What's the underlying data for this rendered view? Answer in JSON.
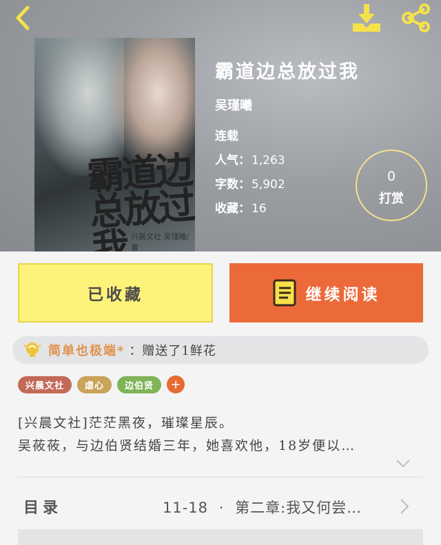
{
  "icons": {
    "back": "back-chevron-icon",
    "download": "download-icon",
    "share": "share-icon",
    "read": "book-icon",
    "flower": "lightbulb-icon",
    "expand": "chevron-down-icon",
    "toc": "chevron-right-icon"
  },
  "colors": {
    "accent_yellow": "#f5e24a",
    "fav_button": "#fdf27a",
    "read_button": "#ec6a3a",
    "flower_user": "#e0914a"
  },
  "cover": {
    "art_title": "霸道边总放过我",
    "art_author": "兴晨文社  吴瑾曦/著"
  },
  "book": {
    "title": "霸道边总放过我",
    "author": "吴瑾曦",
    "status": "连载",
    "popularity_label": "人气：",
    "popularity": "1,263",
    "words_label": "字数：",
    "words": "5,902",
    "favorites_label": "收藏：",
    "favorites": "16"
  },
  "tip": {
    "count": "0",
    "label": "打赏"
  },
  "actions": {
    "favorited": "已收藏",
    "continue_reading": "继续阅读"
  },
  "flower": {
    "user": "简单也极端*",
    "message": "：赠送了1鲜花"
  },
  "tags": [
    "兴晨文社",
    "虐心",
    "边伯贤"
  ],
  "tag_add": "+",
  "description": {
    "line1": "[兴晨文社]茫茫黑夜，璀璨星辰。",
    "line2": "吴莜莜，与边伯贤结婚三年，她喜欢他，18岁便以…"
  },
  "toc": {
    "label": "目录",
    "latest_date": "11-18",
    "separator": "·",
    "latest_chapter": "第二章:我又何尝…"
  }
}
